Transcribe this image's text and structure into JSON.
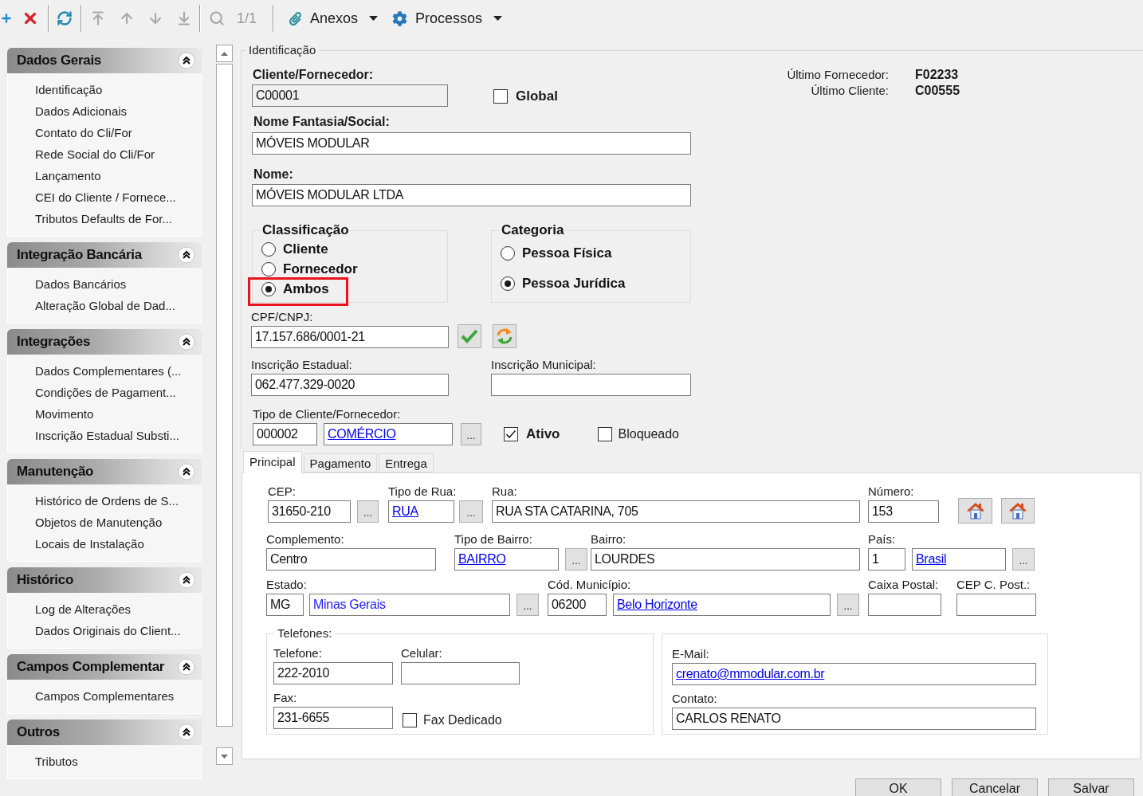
{
  "toolbar": {
    "groups": [
      [
        {
          "kind": "add",
          "disabled": false
        },
        {
          "kind": "delete",
          "disabled": false
        }
      ],
      [
        {
          "kind": "refresh",
          "disabled": false
        }
      ],
      [
        {
          "kind": "first",
          "disabled": true
        },
        {
          "kind": "previous",
          "disabled": true
        },
        {
          "kind": "next",
          "disabled": true
        },
        {
          "kind": "last",
          "disabled": true
        }
      ],
      [
        {
          "kind": "search",
          "disabled": true
        }
      ]
    ],
    "page_counter": "1/1",
    "menus": [
      {
        "kind": "attachments",
        "label": "Anexos"
      },
      {
        "kind": "processes",
        "label": "Processos"
      }
    ]
  },
  "sidebar": {
    "sections": [
      {
        "title": "Dados Gerais",
        "expanded": true,
        "items": [
          "Identificação",
          "Dados Adicionais",
          "Contato do Cli/For",
          "Rede Social do Cli/For",
          "Lançamento",
          "CEI do Cliente / Fornece...",
          "Tributos Defaults de For..."
        ]
      },
      {
        "title": "Integração Bancária",
        "expanded": true,
        "items": [
          "Dados Bancários",
          "Alteração Global de Dad..."
        ]
      },
      {
        "title": "Integrações",
        "expanded": true,
        "items": [
          "Dados Complementares (...",
          "Condições de Pagament...",
          "Movimento",
          "Inscrição Estadual Substi..."
        ]
      },
      {
        "title": "Manutenção",
        "expanded": true,
        "items": [
          "Histórico de Ordens de S...",
          "Objetos de Manutenção",
          "Locais de Instalação"
        ]
      },
      {
        "title": "Histórico",
        "expanded": true,
        "items": [
          "Log de Alterações",
          "Dados Originais do Client..."
        ]
      },
      {
        "title": "Campos Complementar",
        "expanded": true,
        "items": [
          "Campos Complementares"
        ]
      },
      {
        "title": "Outros",
        "expanded": true,
        "items": [
          "Tributos"
        ]
      }
    ]
  },
  "identificacao": {
    "title": "Identificação",
    "cliente_fornecedor": {
      "label": "Cliente/Fornecedor:",
      "value": "C00001",
      "disabled": true
    },
    "global": {
      "label": "Global",
      "checked": false
    },
    "nome_fantasia": {
      "label": "Nome Fantasia/Social:",
      "value": "MÓVEIS MODULAR"
    },
    "nome": {
      "label": "Nome:",
      "value": "MÓVEIS MODULAR LTDA"
    },
    "classificacao": {
      "title": "Classificação",
      "options": [
        {
          "label": "Cliente",
          "selected": false,
          "highlighted": false
        },
        {
          "label": "Fornecedor",
          "selected": false,
          "highlighted": false
        },
        {
          "label": "Ambos",
          "selected": true,
          "highlighted": true
        }
      ]
    },
    "categoria": {
      "title": "Categoria",
      "options": [
        {
          "label": "Pessoa Física",
          "selected": false
        },
        {
          "label": "Pessoa Jurídica",
          "selected": true
        }
      ]
    },
    "cpf_cnpj": {
      "label": "CPF/CNPJ:",
      "value": "17.157.686/0001-21"
    },
    "inscricao_estadual": {
      "label": "Inscrição Estadual:",
      "value": "062.477.329-0020"
    },
    "inscricao_municipal": {
      "label": "Inscrição Municipal:"
    },
    "tipo_cliente": {
      "label": "Tipo de Cliente/Fornecedor:",
      "code": "000002",
      "name": "COMÉRCIO",
      "button": "..."
    },
    "ativo": {
      "label": "Ativo",
      "checked": true
    },
    "bloqueado": {
      "label": "Bloqueado",
      "checked": false
    },
    "ultimo": [
      {
        "label": "Último Fornecedor:",
        "value": "F02233"
      },
      {
        "label": "Último Cliente:",
        "value": "C00555"
      }
    ]
  },
  "tabs": [
    {
      "label": "Principal",
      "selected": true
    },
    {
      "label": "Pagamento",
      "selected": false
    },
    {
      "label": "Entrega",
      "selected": false
    }
  ],
  "principal": {
    "cep": {
      "label": "CEP:",
      "value": "31650-210",
      "button": "..."
    },
    "tipo_rua": {
      "label": "Tipo de Rua:",
      "value": "RUA",
      "button": "..."
    },
    "rua": {
      "label": "Rua:",
      "value": "RUA STA CATARINA, 705"
    },
    "numero": {
      "label": "Número:",
      "value": "153"
    },
    "complemento": {
      "label": "Complemento:",
      "value": "Centro"
    },
    "tipo_bairro": {
      "label": "Tipo de Bairro:",
      "value": "BAIRRO",
      "button": "..."
    },
    "bairro": {
      "label": "Bairro:",
      "value": "LOURDES"
    },
    "pais": {
      "label": "País:",
      "code": "1",
      "name": "Brasil",
      "button": "..."
    },
    "estado": {
      "label": "Estado:",
      "code": "MG",
      "name": "Minas Gerais",
      "button": "..."
    },
    "municipio": {
      "label": "Cód. Município:",
      "code": "06200",
      "name": "Belo Horizonte",
      "button": "..."
    },
    "caixa_postal": {
      "label": "Caixa Postal:"
    },
    "cep_caixa_postal": {
      "label": "CEP C. Post.:"
    },
    "telefones": {
      "title": "Telefones:",
      "telefone": {
        "label": "Telefone:",
        "value": "222-2010"
      },
      "celular": {
        "label": "Celular:"
      },
      "fax": {
        "label": "Fax:",
        "value": "231-6655"
      },
      "fax_dedicado": {
        "label": "Fax Dedicado",
        "checked": false
      }
    },
    "contato": {
      "email": {
        "label": "E-Mail:",
        "value": "crenato@mmodular.com.br"
      },
      "nome": {
        "label": "Contato:",
        "value": "CARLOS RENATO"
      }
    }
  },
  "buttons": [
    "OK",
    "Cancelar",
    "Salvar"
  ]
}
